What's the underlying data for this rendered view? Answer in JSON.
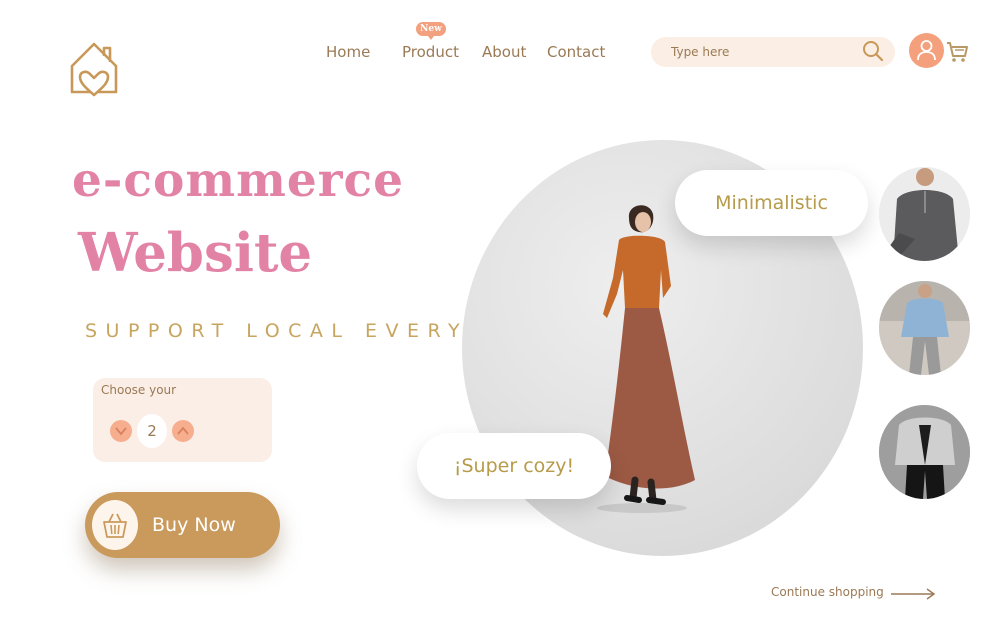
{
  "nav": {
    "home": "Home",
    "product": "Product",
    "product_badge": "New",
    "about": "About",
    "contact": "Contact"
  },
  "search": {
    "placeholder": "Type here"
  },
  "hero": {
    "title_line1": "e-commerce",
    "title_line2": "Website",
    "tagline": "SUPPORT LOCAL EVERYTHING"
  },
  "quantity": {
    "label": "Choose your",
    "value": "2"
  },
  "buy_button": {
    "label": "Buy Now"
  },
  "bubbles": {
    "top": "Minimalistic",
    "bottom": "¡Super cozy!"
  },
  "continue": {
    "label": "Continue shopping"
  },
  "colors": {
    "brand_pink": "#e283a6",
    "accent_orange": "#f4a07d",
    "buy_button": "#c99a5c",
    "text_brown": "#9a7a55"
  },
  "icons": {
    "logo": "house-heart-icon",
    "search": "search-icon",
    "user": "user-icon",
    "cart": "cart-icon",
    "basket": "basket-icon",
    "arrow": "arrow-right-icon"
  }
}
